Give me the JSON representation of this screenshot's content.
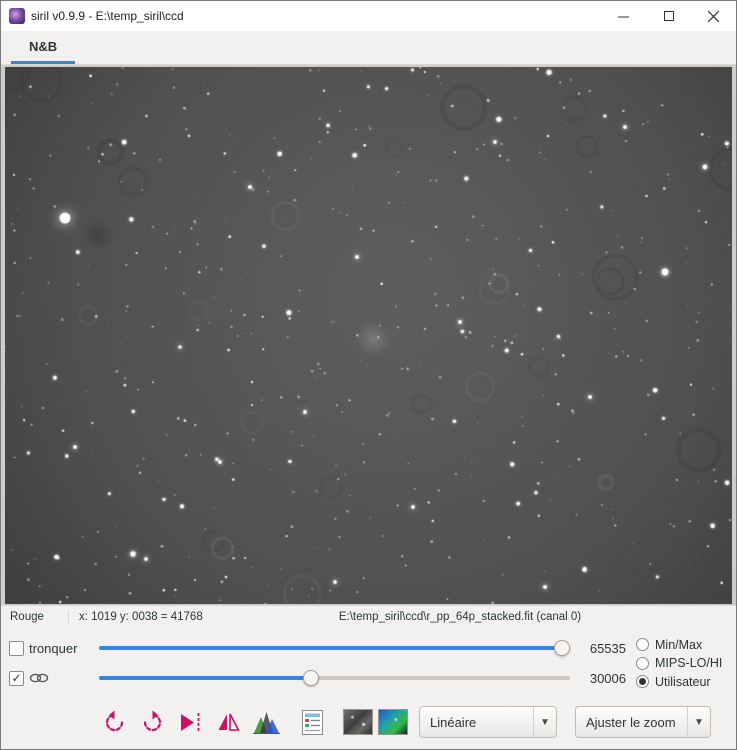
{
  "window": {
    "title": "siril v0.9.9 - E:\\temp_siril\\ccd"
  },
  "tabs": [
    {
      "label": "N&B"
    }
  ],
  "statusbar": {
    "channel": "Rouge",
    "coords": "x: 1019 y: 0038 = 41768",
    "file": "E:\\temp_siril\\ccd\\r_pp_64p_stacked.fit (canal 0)"
  },
  "controls": {
    "truncate_label": "tronquer",
    "truncate_checked": false,
    "link_checked": true,
    "high_value": "65535",
    "low_value": "30006",
    "radios": [
      {
        "label": "Min/Max",
        "selected": false
      },
      {
        "label": "MIPS-LO/HI",
        "selected": false
      },
      {
        "label": "Utilisateur",
        "selected": true
      }
    ]
  },
  "toolbar": {
    "mode_dropdown": "Linéaire",
    "zoom_dropdown": "Ajuster le zoom",
    "icons": [
      "rotate-left-icon",
      "rotate-right-icon",
      "flip-horizontal-icon",
      "mirror-icon",
      "histogram-icon",
      "processing-list-icon",
      "gray-thumbnail",
      "color-thumbnail"
    ]
  },
  "colors": {
    "accent_blue": "#3584e4",
    "icon_pink": "#cc1166"
  }
}
